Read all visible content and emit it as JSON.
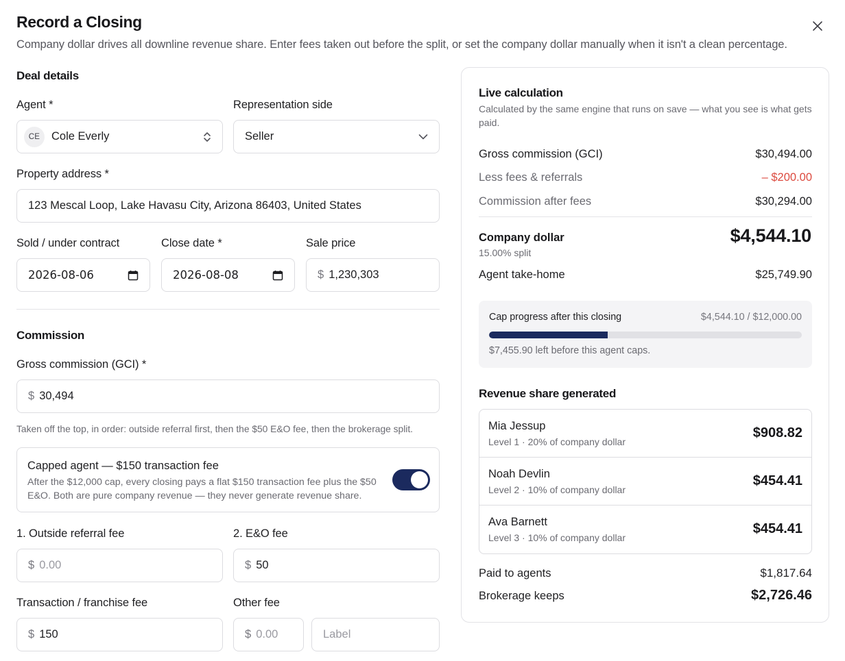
{
  "header": {
    "title": "Record a Closing",
    "subtitle": "Company dollar drives all downline revenue share. Enter fees taken out before the split, or set the company dollar manually when it isn't a clean percentage.",
    "close_icon": "close-icon"
  },
  "deal": {
    "section_title": "Deal details",
    "agent_label": "Agent *",
    "agent_initials": "CE",
    "agent_name": "Cole Everly",
    "side_label": "Representation side",
    "side_value": "Seller",
    "address_label": "Property address *",
    "address_value": "123 Mescal Loop, Lake Havasu City, Arizona 86403, United States",
    "sold_label": "Sold / under contract",
    "sold_value": "2026-08-06",
    "close_label": "Close date *",
    "close_value": "2026-08-08",
    "price_label": "Sale price",
    "price_prefix": "$",
    "price_value": "1,230,303"
  },
  "commission": {
    "section_title": "Commission",
    "gci_label": "Gross commission (GCI) *",
    "gci_prefix": "$",
    "gci_value": "30,494",
    "hint": "Taken off the top, in order: outside referral first, then the $50 E&O fee, then the brokerage split.",
    "capped_title": "Capped agent — $150 transaction fee",
    "capped_desc": "After the $12,000 cap, every closing pays a flat $150 transaction fee plus the $50 E&O. Both are pure company revenue — they never generate revenue share.",
    "capped_on": true,
    "referral_label": "1. Outside referral fee",
    "referral_prefix": "$",
    "referral_placeholder": "0.00",
    "eo_label": "2. E&O fee",
    "eo_prefix": "$",
    "eo_value": "50",
    "transaction_label": "Transaction / franchise fee",
    "transaction_prefix": "$",
    "transaction_value": "150",
    "other_label": "Other fee",
    "other_prefix": "$",
    "other_placeholder": "0.00",
    "other_label_placeholder": "Label"
  },
  "calc": {
    "title": "Live calculation",
    "subtitle": "Calculated by the same engine that runs on save — what you see is what gets paid.",
    "gci_label": "Gross commission (GCI)",
    "gci_value": "$30,494.00",
    "fees_label": "Less fees & referrals",
    "fees_value": "– $200.00",
    "after_label": "Commission after fees",
    "after_value": "$30,294.00",
    "company_label": "Company dollar",
    "company_split": "15.00% split",
    "company_value": "$4,544.10",
    "takehome_label": "Agent take-home",
    "takehome_value": "$25,749.90",
    "cap_label": "Cap progress after this closing",
    "cap_value": "$4,544.10 / $12,000.00",
    "cap_progress": 0.3787,
    "cap_note": "$7,455.90 left before this agent caps.",
    "rs_title": "Revenue share generated",
    "rs": [
      {
        "name": "Mia Jessup",
        "level": "Level 1 · 20% of company dollar",
        "amount": "$908.82"
      },
      {
        "name": "Noah Devlin",
        "level": "Level 2 · 10% of company dollar",
        "amount": "$454.41"
      },
      {
        "name": "Ava Barnett",
        "level": "Level 3 · 10% of company dollar",
        "amount": "$454.41"
      }
    ],
    "paid_label": "Paid to agents",
    "paid_value": "$1,817.64",
    "keeps_label": "Brokerage keeps",
    "keeps_value": "$2,726.46"
  },
  "colors": {
    "accent": "#1b2a5e",
    "negative": "#dc4a3f"
  }
}
